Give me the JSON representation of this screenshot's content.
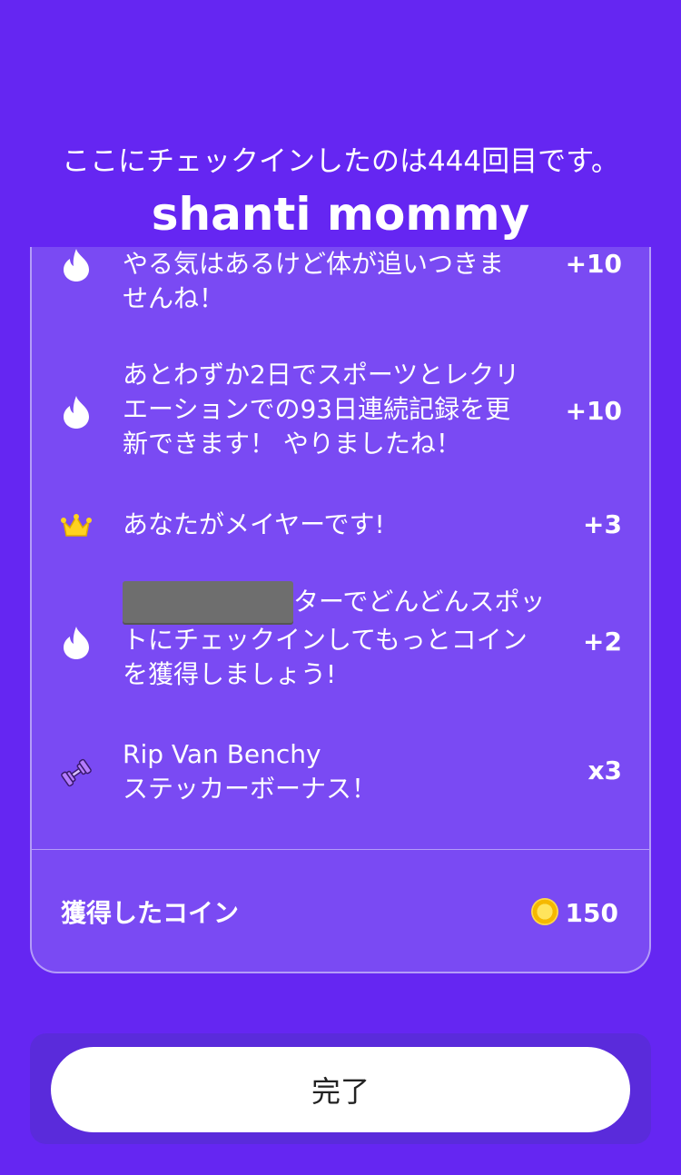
{
  "header": {
    "checkin_message": "ここにチェックインしたのは444回目です。",
    "venue_name": "shanti mommy"
  },
  "rewards": [
    {
      "icon": "flame-icon",
      "lines": [
        "やる気はあるけど体が追いつきま",
        "せんね！"
      ],
      "points": "+10"
    },
    {
      "icon": "flame-icon",
      "lines": [
        "あとわずか2日でスポーツとレクリ",
        "エーションでの93日連続記録を更",
        "新できます！ やりましたね！"
      ],
      "points": "+10"
    },
    {
      "icon": "crown-icon",
      "lines": [
        "あなたがメイヤーです!"
      ],
      "points": "+3"
    },
    {
      "icon": "flame-icon",
      "lines": [
        "ターでどんどんスポッ",
        "トにチェックインしてもっとコイン",
        "を獲得しましょう!"
      ],
      "points": "+2"
    },
    {
      "icon": "dumbbell-sticker-icon",
      "lines": [
        "Rip Van Benchy",
        "ステッカーボーナス！"
      ],
      "points": "x3"
    }
  ],
  "total": {
    "label": "獲得したコイン",
    "value": "150",
    "icon": "coin-icon"
  },
  "footer": {
    "done_label": "完了"
  },
  "colors": {
    "background": "#6526F2",
    "card": "#7A4AF3",
    "card_border": "#B49CF8",
    "coin": "#F5B800"
  }
}
